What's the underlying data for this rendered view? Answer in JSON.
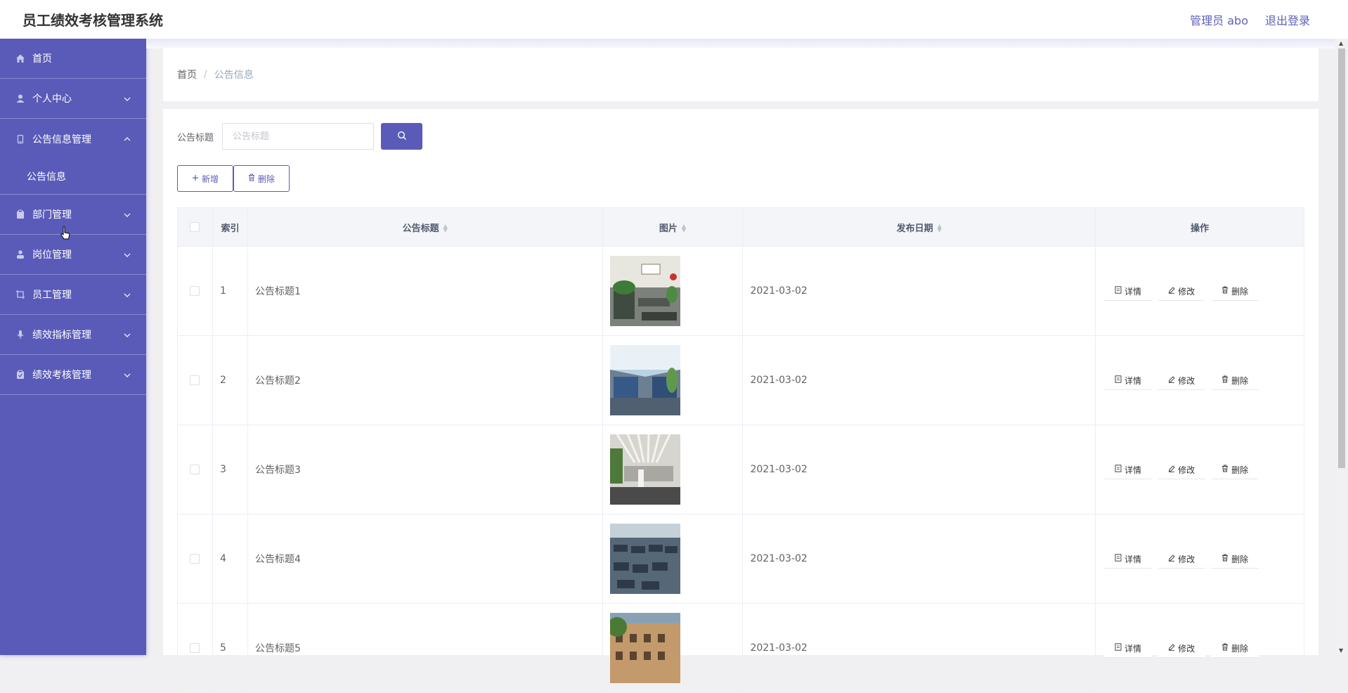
{
  "app": {
    "title": "员工绩效考核管理系统",
    "user_label": "管理员 abo",
    "logout_label": "退出登录"
  },
  "sidebar": {
    "items": [
      {
        "label": "首页",
        "icon": "home-icon",
        "chevron": ""
      },
      {
        "label": "个人中心",
        "icon": "user-icon",
        "chevron": "down"
      },
      {
        "label": "公告信息管理",
        "icon": "document-icon",
        "chevron": "up",
        "expanded": true
      },
      {
        "label": "部门管理",
        "icon": "clipboard-icon",
        "chevron": "down"
      },
      {
        "label": "岗位管理",
        "icon": "person-icon",
        "chevron": "down"
      },
      {
        "label": "员工管理",
        "icon": "crop-icon",
        "chevron": "down"
      },
      {
        "label": "绩效指标管理",
        "icon": "microphone-icon",
        "chevron": "down"
      },
      {
        "label": "绩效考核管理",
        "icon": "clipboard-check-icon",
        "chevron": "down"
      }
    ],
    "sub_items": [
      "公告信息"
    ]
  },
  "breadcrumb": {
    "home": "首页",
    "separator": "/",
    "current": "公告信息"
  },
  "search": {
    "label": "公告标题",
    "placeholder": "公告标题"
  },
  "buttons": {
    "add": "新增",
    "delete": "删除"
  },
  "table": {
    "columns": [
      "索引",
      "公告标题",
      "图片",
      "发布日期",
      "操作"
    ],
    "rows": [
      {
        "index": "1",
        "title": "公告标题1",
        "date": "2021-03-02"
      },
      {
        "index": "2",
        "title": "公告标题2",
        "date": "2021-03-02"
      },
      {
        "index": "3",
        "title": "公告标题3",
        "date": "2021-03-02"
      },
      {
        "index": "4",
        "title": "公告标题4",
        "date": "2021-03-02"
      },
      {
        "index": "5",
        "title": "公告标题5",
        "date": "2021-03-02"
      }
    ],
    "row_actions": {
      "detail": "详情",
      "edit": "修改",
      "delete": "删除"
    }
  },
  "colors": {
    "accent": "#5a5bb8",
    "sidebar_bg": "#5a5bb8",
    "header_text": "#5e60b6"
  }
}
